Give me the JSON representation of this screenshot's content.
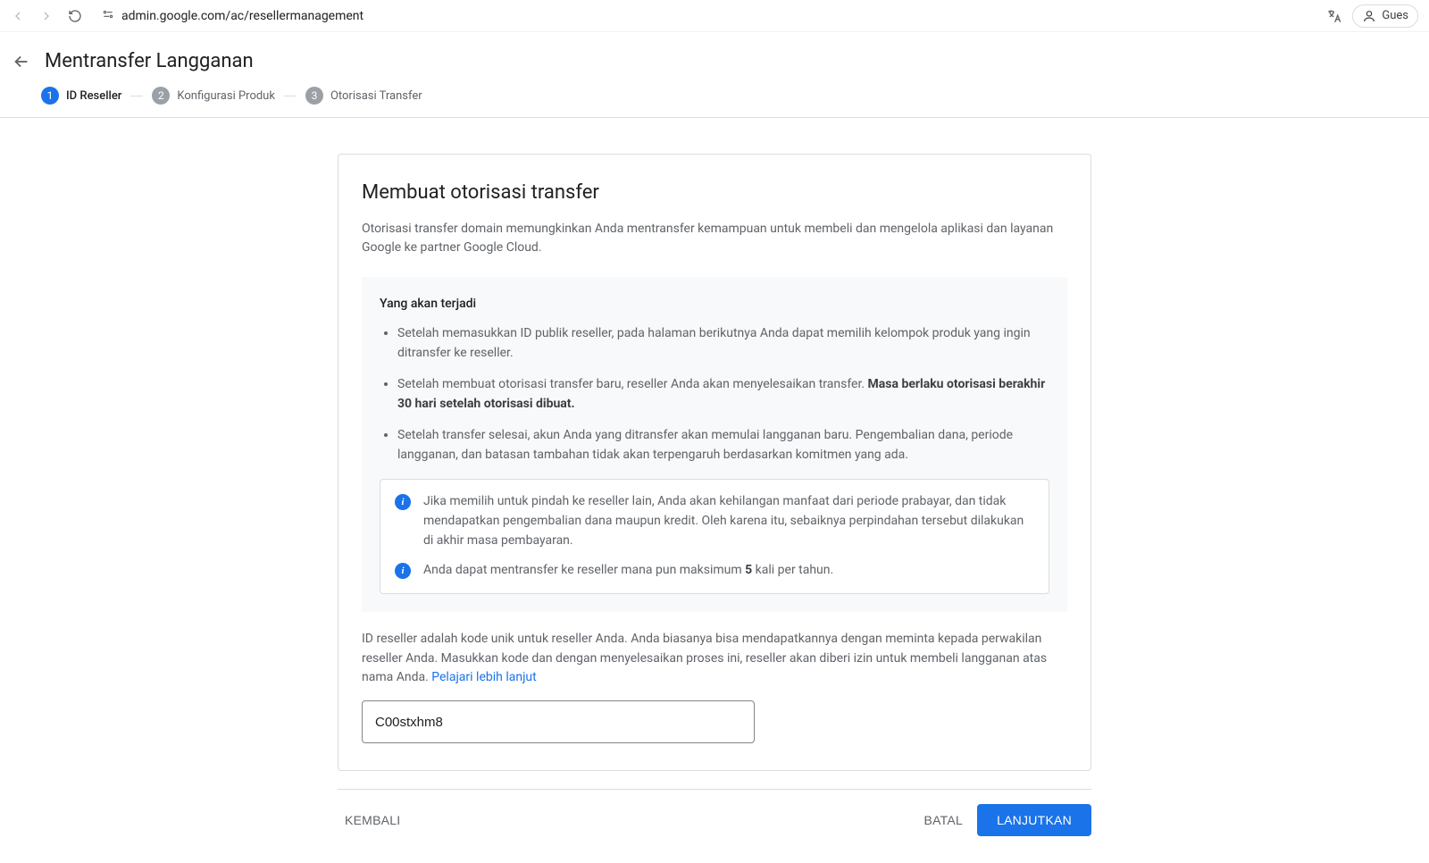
{
  "browser": {
    "url": "admin.google.com/ac/resellermanagement",
    "guest_label": "Gues"
  },
  "header": {
    "title": "Mentransfer Langganan"
  },
  "stepper": {
    "steps": [
      {
        "num": "1",
        "label": "ID Reseller"
      },
      {
        "num": "2",
        "label": "Konfigurasi Produk"
      },
      {
        "num": "3",
        "label": "Otorisasi Transfer"
      }
    ]
  },
  "card": {
    "title": "Membuat otorisasi transfer",
    "description": "Otorisasi transfer domain memungkinkan Anda mentransfer kemampuan untuk membeli dan mengelola aplikasi dan layanan Google ke partner Google Cloud.",
    "info_title": "Yang akan terjadi",
    "bullets": [
      "Setelah memasukkan ID publik reseller, pada halaman berikutnya Anda dapat memilih kelompok produk yang ingin ditransfer ke reseller."
    ],
    "bullet2_pre": "Setelah membuat otorisasi transfer baru, reseller Anda akan menyelesaikan transfer. ",
    "bullet2_bold": "Masa berlaku otorisasi berakhir 30 hari setelah otorisasi dibuat.",
    "bullet3": "Setelah transfer selesai, akun Anda yang ditransfer akan memulai langganan baru. Pengembalian dana, periode langganan, dan batasan tambahan tidak akan terpengaruh berdasarkan komitmen yang ada.",
    "notice1": "Jika memilih untuk pindah ke reseller lain, Anda akan kehilangan manfaat dari periode prabayar, dan tidak mendapatkan pengembalian dana maupun kredit. Oleh karena itu, sebaiknya perpindahan tersebut dilakukan di akhir masa pembayaran.",
    "notice2_pre": "Anda dapat mentransfer ke reseller mana pun maksimum ",
    "notice2_bold": "5",
    "notice2_post": " kali per tahun.",
    "helper_pre": "ID reseller adalah kode unik untuk reseller Anda. Anda biasanya bisa mendapatkannya dengan meminta kepada perwakilan reseller Anda. Masukkan kode dan dengan menyelesaikan proses ini, reseller akan diberi izin untuk membeli langganan atas nama Anda. ",
    "helper_link": "Pelajari lebih lanjut",
    "input_value": "C00stxhm8"
  },
  "footer": {
    "back": "KEMBALI",
    "cancel": "BATAL",
    "continue": "LANJUTKAN"
  }
}
